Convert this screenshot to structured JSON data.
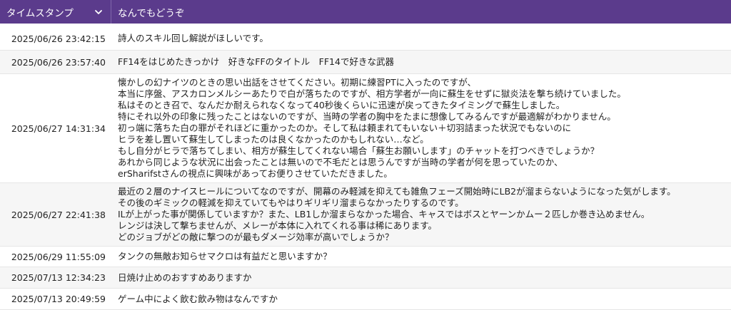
{
  "header": {
    "timestamp_label": "タイムスタンプ",
    "question_label": "なんでもどうぞ",
    "timestamp_sort_icon": "chevron-down-icon"
  },
  "colors": {
    "header_bg": "#5b3b8c",
    "header_text": "#ffffff",
    "row_alt": "#f6f6f6"
  },
  "rows": [
    {
      "timestamp": "2025/06/26 23:42:15",
      "text": "詩人のスキル回し解説がほしいです。"
    },
    {
      "timestamp": "2025/06/26 23:57:40",
      "text": "FF14をはじめたきっかけ　好きなFFのタイトル　FF14で好きな武器"
    },
    {
      "timestamp": "2025/06/27 14:31:34",
      "text": "懐かしの幻ナイツのときの思い出話をさせてください。初期に練習PTに入ったのですが、\n本当に序盤、アスカロンメルシーあたりで白が落ちたのですが、相方学者が一向に蘇生をせずに獄炎法を撃ち続けていました。\n私はそのとき召で、なんだか耐えられなくなって40秒後くらいに迅速が戻ってきたタイミングで蘇生しました。\n特にそれ以外の印象に残ったことはないのですが、当時の学者の胸中をたまに想像してみるんですが最適解がわかりません。\n初っ端に落ちた白の罪がそれほどに重かったのか。そして私は頼まれてもいない＋切羽詰まった状況でもないのに\nヒラを差し置いて蘇生してしまったのは良くなかったのかもしれない…など。\nもし自分がヒラで落ちてしまい、相方が蘇生してくれない場合「蘇生お願いします」のチャットを打つべきでしょうか？\nあれから同じような状況に出会ったことは無いので不毛だとは思うんですが当時の学者が何を思っていたのか、\nerSharifstさんの視点に興味があってお便りさせていただきました。"
    },
    {
      "timestamp": "2025/06/27 22:41:38",
      "text": "最近の２層のナイスヒールについてなのですが、開幕のみ軽減を抑えても雑魚フェーズ開始時にLB2が溜まらないようになった気がします。\nその後のギミックの軽減を抑えていてもやはりギリギリ溜まらなかったりするのです。\nILが上がった事が関係していますか？また、LB1しか溜まらなかった場合、キャスではボスとヤーンかムー２匹しか巻き込めません。\nレンジは決して撃ちませんが、メレーが本体に入れてくれる事は稀にあります。\nどのジョブがどの敵に撃つのが最もダメージ効率が高いでしょうか？"
    },
    {
      "timestamp": "2025/06/29 11:55:09",
      "text": "タンクの無敵お知らせマクロは有益だと思いますか？"
    },
    {
      "timestamp": "2025/07/13 12:34:23",
      "text": "日焼け止めのおすすめありますか"
    },
    {
      "timestamp": "2025/07/13 20:49:59",
      "text": "ゲーム中によく飲む飲み物はなんですか"
    }
  ]
}
